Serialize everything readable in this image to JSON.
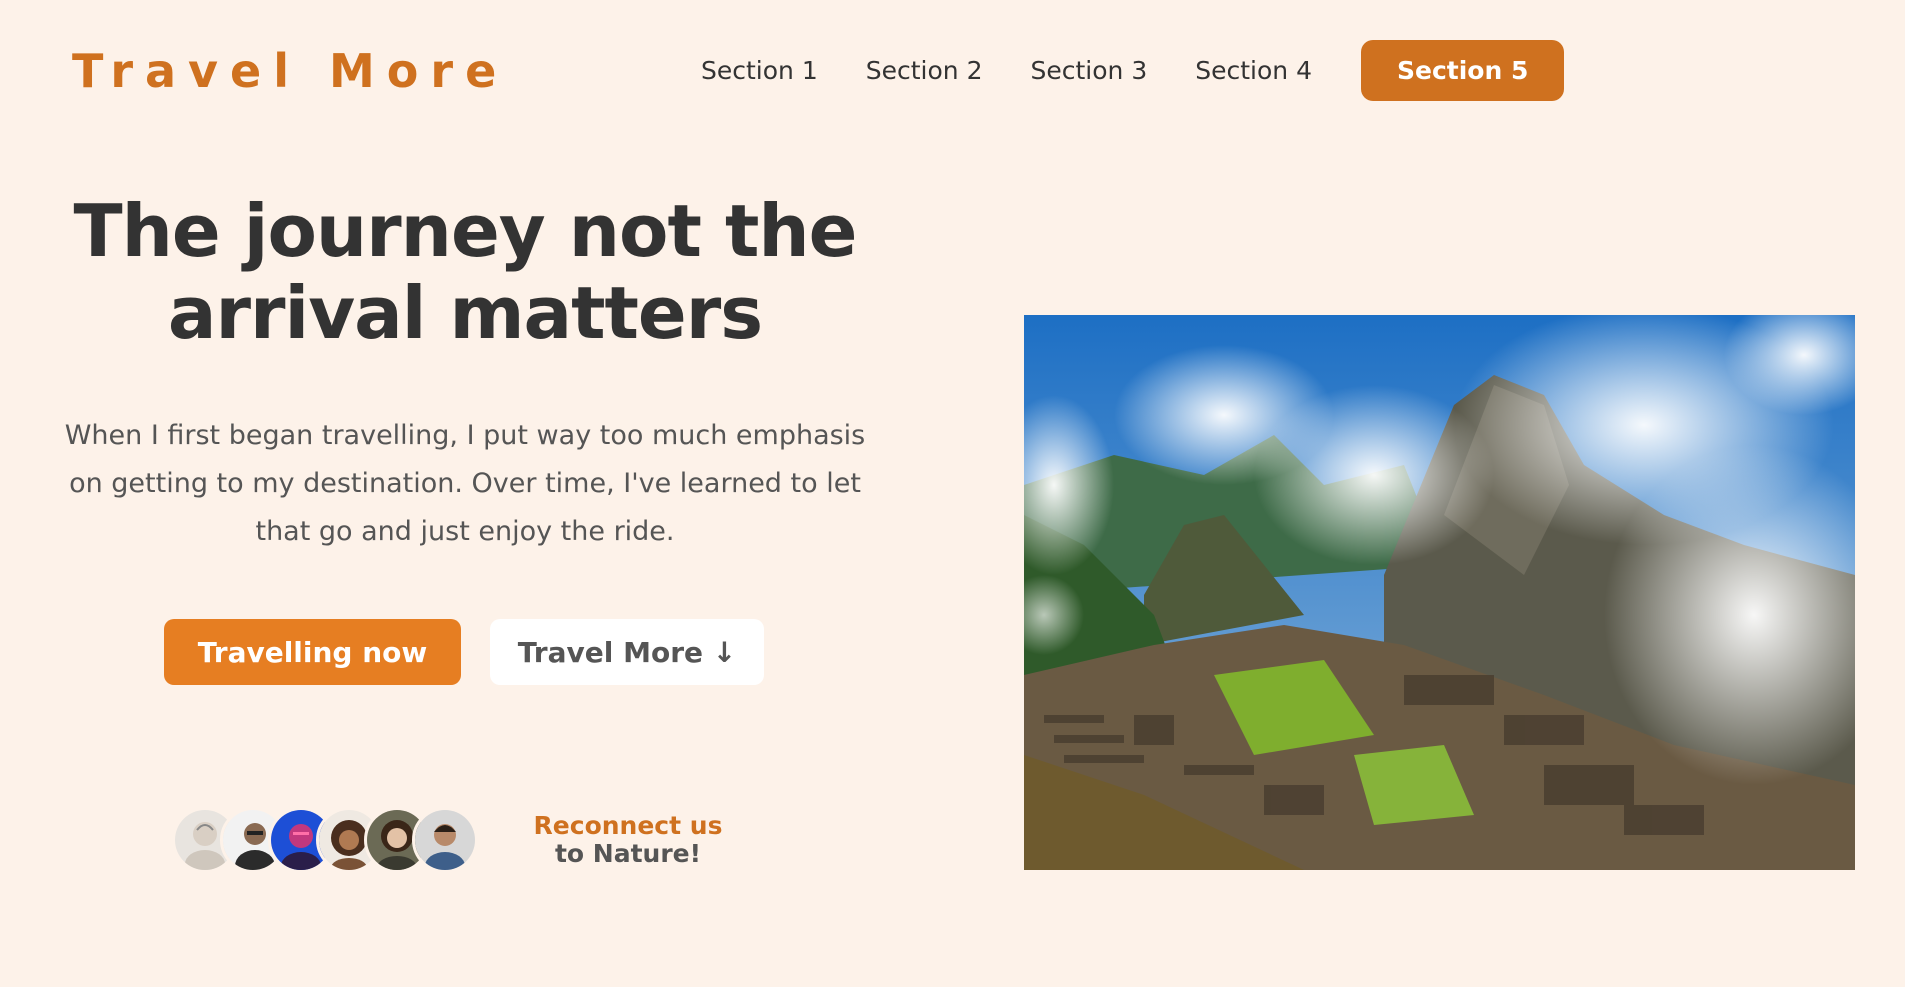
{
  "header": {
    "logo": "Travel More",
    "nav": [
      "Section 1",
      "Section 2",
      "Section 3",
      "Section 4",
      "Section 5"
    ]
  },
  "hero": {
    "headline": "The journey not the arrival matters",
    "description": "When I first began travelling, I put way too much emphasis on getting to my destination. Over time, I've learned to let that go and just enjoy the ride.",
    "primary_button": "Travelling now",
    "secondary_button": "Travel More ↓",
    "customers": {
      "accent_text": "Reconnect us",
      "rest_text": " to Nature!",
      "avatar_count": 6
    },
    "image_alt": "Machu Picchu mountains with clouds"
  },
  "colors": {
    "background": "#fdf2e9",
    "brand": "#cf711f",
    "primary_button": "#e67e22",
    "text": "#333333"
  }
}
